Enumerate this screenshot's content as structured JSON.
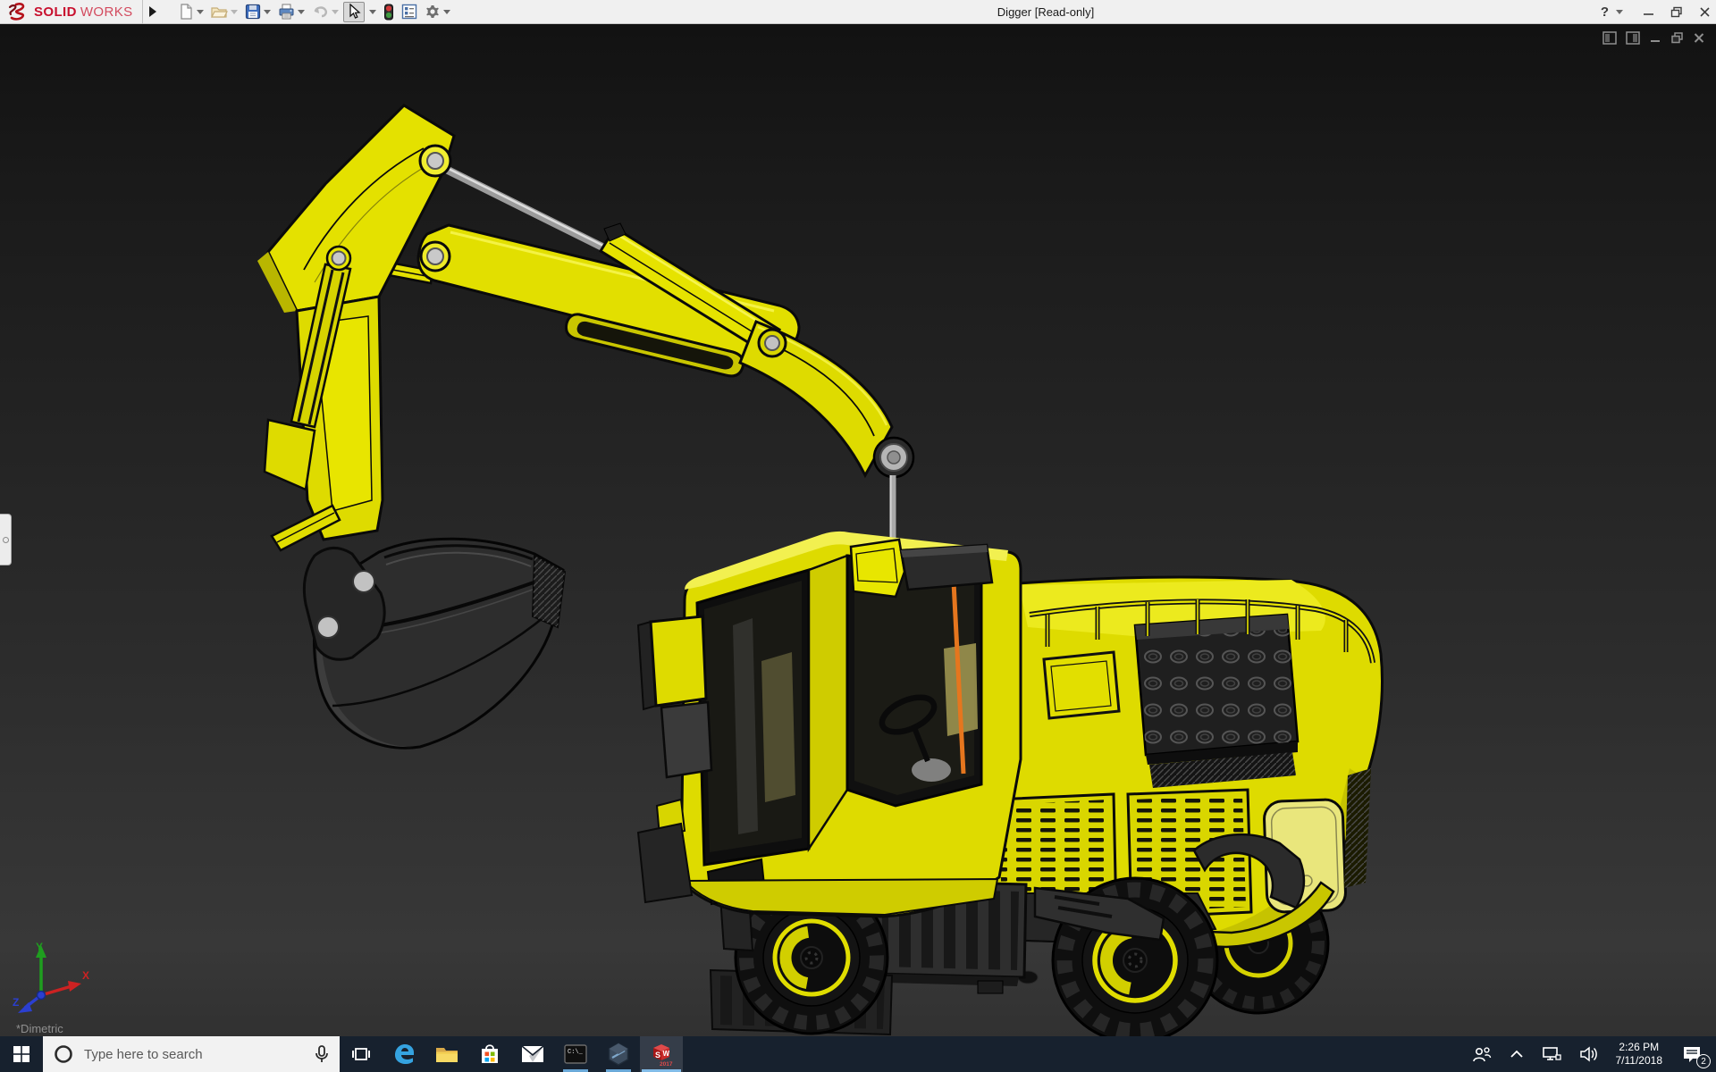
{
  "titlebar": {
    "logo_bold": "SOLID",
    "logo_light": "WORKS",
    "title": "Digger [Read-only]",
    "help": "?",
    "tools": [
      "new-document",
      "open",
      "save",
      "print",
      "undo",
      "select",
      "rebuild",
      "options-list",
      "settings"
    ]
  },
  "document_controls": [
    "pane-left-icon",
    "pane-right-icon",
    "minimize",
    "restore",
    "close"
  ],
  "viewport": {
    "view_label": "*Dimetric",
    "model": "Digger excavator 3D model (yellow, shaded with edges)",
    "triad": {
      "x": "X",
      "y": "Y",
      "z": "Z"
    }
  },
  "taskbar": {
    "search_placeholder": "Type here to search",
    "apps": [
      "start",
      "task-view",
      "edge",
      "file-explorer",
      "store",
      "mail",
      "command-prompt",
      "cad-hexagon-app",
      "solidworks-2017"
    ],
    "running_apps": [
      "command-prompt",
      "cad-hexagon-app",
      "solidworks-2017"
    ],
    "cmd_text": "C:\\_",
    "sw_icon": {
      "s": "S",
      "w": "W",
      "year": "2017"
    }
  },
  "tray": {
    "icons": [
      "people",
      "hidden-icons-chevron",
      "network",
      "volume",
      "action-center"
    ],
    "time": "2:26 PM",
    "date": "7/11/2018",
    "notification_count": "2"
  },
  "colors": {
    "machine_yellow": "#e2df00",
    "taskbar": "#17212e",
    "run_indicator": "#6aa9d8",
    "solidworks_red": "#c8102e",
    "viewport_dark": "#242424"
  }
}
